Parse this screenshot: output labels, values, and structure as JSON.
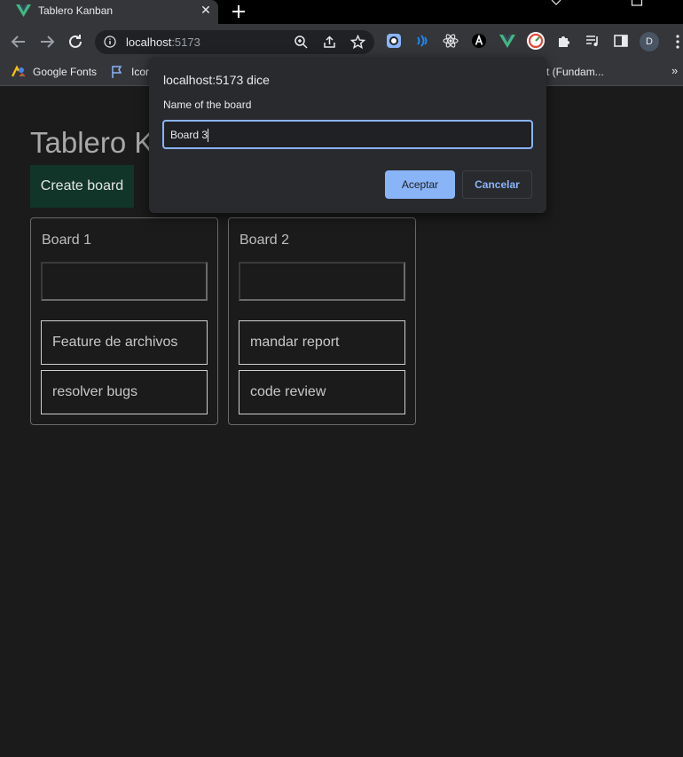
{
  "browser": {
    "tab": {
      "title": "Tablero Kanban",
      "close_label": "✕"
    },
    "omnibox": {
      "host": "localhost",
      "port": ":5173"
    },
    "bookmarks": [
      {
        "label": "Google Fonts",
        "icon": "google-fonts-icon"
      },
      {
        "label": "Icor",
        "icon": "flag-icon"
      },
      {
        "label": "t (Fundam...",
        "icon": ""
      }
    ],
    "bookmarks_more": "»",
    "profile_initial": "D",
    "extension_icons": [
      "chrome-ext-icon",
      "wave-icon",
      "react-icon",
      "a-icon",
      "vue-icon",
      "speed-icon",
      "puzzle-icon",
      "playlist-icon",
      "sidepanel-icon"
    ]
  },
  "page": {
    "title": "Tablero K",
    "create_button": "Create board",
    "boards": [
      {
        "title": "Board 1",
        "cards": [
          "Feature de archivos",
          "resolver bugs"
        ]
      },
      {
        "title": "Board 2",
        "cards": [
          "mandar report",
          "code review"
        ]
      }
    ]
  },
  "dialog": {
    "origin": "localhost:5173 dice",
    "message": "Name of the board",
    "input_value": "Board 3",
    "ok_label": "Aceptar",
    "cancel_label": "Cancelar"
  },
  "colors": {
    "page_bg": "#1b1b1b",
    "create_button_bg": "#12352a",
    "dialog_accent": "#8ab4f8"
  }
}
